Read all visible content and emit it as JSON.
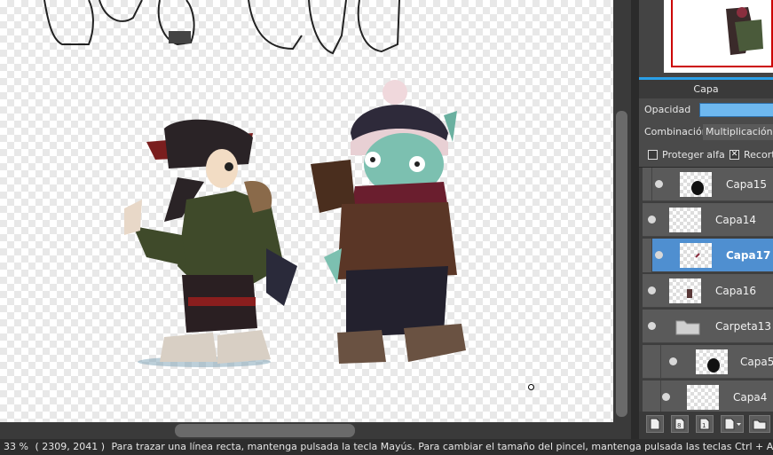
{
  "status_bar": {
    "zoom": "33 %",
    "coords": "( 2309, 2041 )",
    "hint": "Para trazar una línea recta, mantenga pulsada la tecla Mayús. Para cambiar el tamaño del pincel, mantenga pulsada las teclas Ctrl + Alt y arrastre"
  },
  "layer_panel": {
    "title": "Capa",
    "opacity_label": "Opacidad",
    "blend_label": "Combinación",
    "blend_value": "Multiplicación",
    "protect_alpha_label": "Proteger alfa",
    "clipping_label": "Recort",
    "layers": [
      {
        "name": "Capa15",
        "selected": false
      },
      {
        "name": "Capa14",
        "selected": false
      },
      {
        "name": "Capa17",
        "selected": true
      },
      {
        "name": "Capa16",
        "selected": false
      },
      {
        "name": "Carpeta13",
        "selected": false
      },
      {
        "name": "Capa5",
        "selected": false
      },
      {
        "name": "Capa4",
        "selected": false
      }
    ]
  },
  "colors": {
    "accent": "#2aa0e8",
    "selected_layer": "#4f8fd0",
    "opacity_fill": "#6eb8ef",
    "navigator_frame": "#cc0000"
  },
  "icons": [
    "new-layer-icon",
    "new-vector-layer-icon",
    "new-layer-1bit-icon",
    "add-dropdown-icon",
    "new-folder-icon",
    "folder-icon",
    "eye-icon"
  ]
}
